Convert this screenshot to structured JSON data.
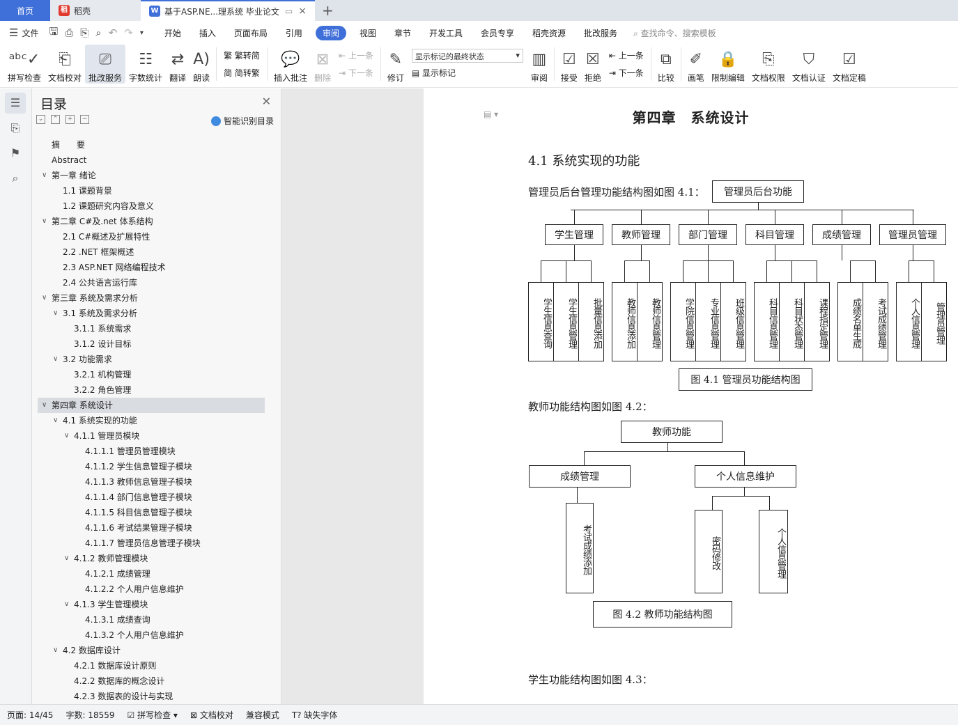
{
  "tabs": {
    "home": "首页",
    "app": "稻壳",
    "doc": "基于ASP.NE...理系统 毕业论文"
  },
  "menu": {
    "items": [
      "开始",
      "插入",
      "页面布局",
      "引用",
      "审阅",
      "视图",
      "章节",
      "开发工具",
      "会员专享",
      "稻壳资源",
      "批改服务"
    ],
    "active": "审阅",
    "file": "文件",
    "search": "查找命令、搜索模板"
  },
  "ribbon": {
    "spell": "拼写检查",
    "proof": "文档校对",
    "review_service": "批改服务",
    "wordcount": "字数统计",
    "translate": "翻译",
    "read": "朗读",
    "trad": "繁转简",
    "simp": "简转繁",
    "insert_comment": "插入批注",
    "delete": "删除",
    "prev": "上一条",
    "next": "下一条",
    "revise": "修订",
    "markup_state": "显示标记的最终状态",
    "show_markup": "显示标记",
    "review": "审阅",
    "accept": "接受",
    "reject": "拒绝",
    "prev2": "上一条",
    "next2": "下一条",
    "compare": "比较",
    "pen": "画笔",
    "restrict": "限制编辑",
    "perm": "文档权限",
    "auth": "文档认证",
    "final": "文档定稿"
  },
  "nav": {
    "title": "目录",
    "smart": "智能识别目录",
    "toc": [
      {
        "label": "摘　　要",
        "level": 0,
        "arrow": false
      },
      {
        "label": "Abstract",
        "level": 0,
        "arrow": false
      },
      {
        "label": "第一章  绪论",
        "level": 0,
        "arrow": true
      },
      {
        "label": "1.1  课题背景",
        "level": 1,
        "arrow": false
      },
      {
        "label": "1.2  课题研究内容及意义",
        "level": 1,
        "arrow": false
      },
      {
        "label": "第二章  C#及.net 体系结构",
        "level": 0,
        "arrow": true
      },
      {
        "label": "2.1 C#概述及扩展特性",
        "level": 1,
        "arrow": false
      },
      {
        "label": "2.2   .NET 框架概述",
        "level": 1,
        "arrow": false
      },
      {
        "label": "2.3 ASP.NET 网络编程技术",
        "level": 1,
        "arrow": false
      },
      {
        "label": "2.4  公共语言运行库",
        "level": 1,
        "arrow": false
      },
      {
        "label": "第三章  系统及需求分析",
        "level": 0,
        "arrow": true
      },
      {
        "label": "3.1 系统及需求分析",
        "level": 1,
        "arrow": true
      },
      {
        "label": "3.1.1  系统需求",
        "level": 2,
        "arrow": false
      },
      {
        "label": "3.1.2  设计目标",
        "level": 2,
        "arrow": false
      },
      {
        "label": "3.2  功能需求",
        "level": 1,
        "arrow": true
      },
      {
        "label": "3.2.1  机构管理",
        "level": 2,
        "arrow": false
      },
      {
        "label": "3.2.2  角色管理",
        "level": 2,
        "arrow": false
      },
      {
        "label": "第四章   系统设计",
        "level": 0,
        "arrow": true,
        "selected": true
      },
      {
        "label": "4.1  系统实现的功能",
        "level": 1,
        "arrow": true
      },
      {
        "label": "4.1.1 管理员模块",
        "level": 2,
        "arrow": true
      },
      {
        "label": "4.1.1.1 管理员管理模块",
        "level": 3,
        "arrow": false
      },
      {
        "label": "4.1.1.2  学生信息管理子模块",
        "level": 3,
        "arrow": false
      },
      {
        "label": "4.1.1.3  教师信息管理子模块",
        "level": 3,
        "arrow": false
      },
      {
        "label": "4.1.1.4  部门信息管理子模块",
        "level": 3,
        "arrow": false
      },
      {
        "label": "4.1.1.5  科目信息管理子模块",
        "level": 3,
        "arrow": false
      },
      {
        "label": "4.1.1.6  考试结果管理子模块",
        "level": 3,
        "arrow": false
      },
      {
        "label": "4.1.1.7  管理员信息管理子模块",
        "level": 3,
        "arrow": false
      },
      {
        "label": "4.1.2  教师管理模块",
        "level": 2,
        "arrow": true
      },
      {
        "label": "4.1.2.1  成绩管理",
        "level": 3,
        "arrow": false
      },
      {
        "label": "4.1.2.2 个人用户信息维护",
        "level": 3,
        "arrow": false
      },
      {
        "label": "4.1.3  学生管理模块",
        "level": 2,
        "arrow": true
      },
      {
        "label": "4.1.3.1  成绩查询",
        "level": 3,
        "arrow": false
      },
      {
        "label": "4.1.3.2 个人用户信息维护",
        "level": 3,
        "arrow": false
      },
      {
        "label": "4.2  数据库设计",
        "level": 1,
        "arrow": true
      },
      {
        "label": "4.2.1    数据库设计原则",
        "level": 2,
        "arrow": false
      },
      {
        "label": "4.2.2  数据库的概念设计",
        "level": 2,
        "arrow": false
      },
      {
        "label": "4.2.3  数据表的设计与实现",
        "level": 2,
        "arrow": false
      }
    ]
  },
  "doc": {
    "chapter": "第四章　系统设计",
    "section": "4.1  系统实现的功能",
    "p1": "管理员后台管理功能结构图如图 4.1：",
    "p2": "教师功能结构图如图 4.2：",
    "p3": "学生功能结构图如图 4.3：",
    "fig1": {
      "root": "管理员后台功能",
      "groups": [
        {
          "name": "学生管理",
          "children": [
            "学生信息查询",
            "学生信息管理",
            "批量信息添加"
          ]
        },
        {
          "name": "教师管理",
          "children": [
            "教师信息添加",
            "教师信息管理"
          ]
        },
        {
          "name": "部门管理",
          "children": [
            "学院信息管理",
            "专业信息管理",
            "班级信息管理"
          ]
        },
        {
          "name": "科目管理",
          "children": [
            "科目信息管理",
            "科目状态管理",
            "课程指定管理"
          ]
        },
        {
          "name": "成绩管理",
          "children": [
            "成绩名单生成",
            "考试成绩管理"
          ]
        },
        {
          "name": "管理员管理",
          "children": [
            "个人信息管理",
            "管理员管理"
          ]
        }
      ],
      "caption": "图 4.1 管理员功能结构图"
    },
    "fig2": {
      "root": "教师功能",
      "g1": "成绩管理",
      "g1c": "考试成绩添加",
      "g2": "个人信息维护",
      "g2c1": "密码修改",
      "g2c2": "个人信息管理",
      "caption": "图 4.2 教师功能结构图"
    }
  },
  "status": {
    "page": "页面: 14/45",
    "words": "字数: 18559",
    "spell": "拼写检查",
    "proof": "文档校对",
    "compat": "兼容模式",
    "font": "缺失字体"
  }
}
